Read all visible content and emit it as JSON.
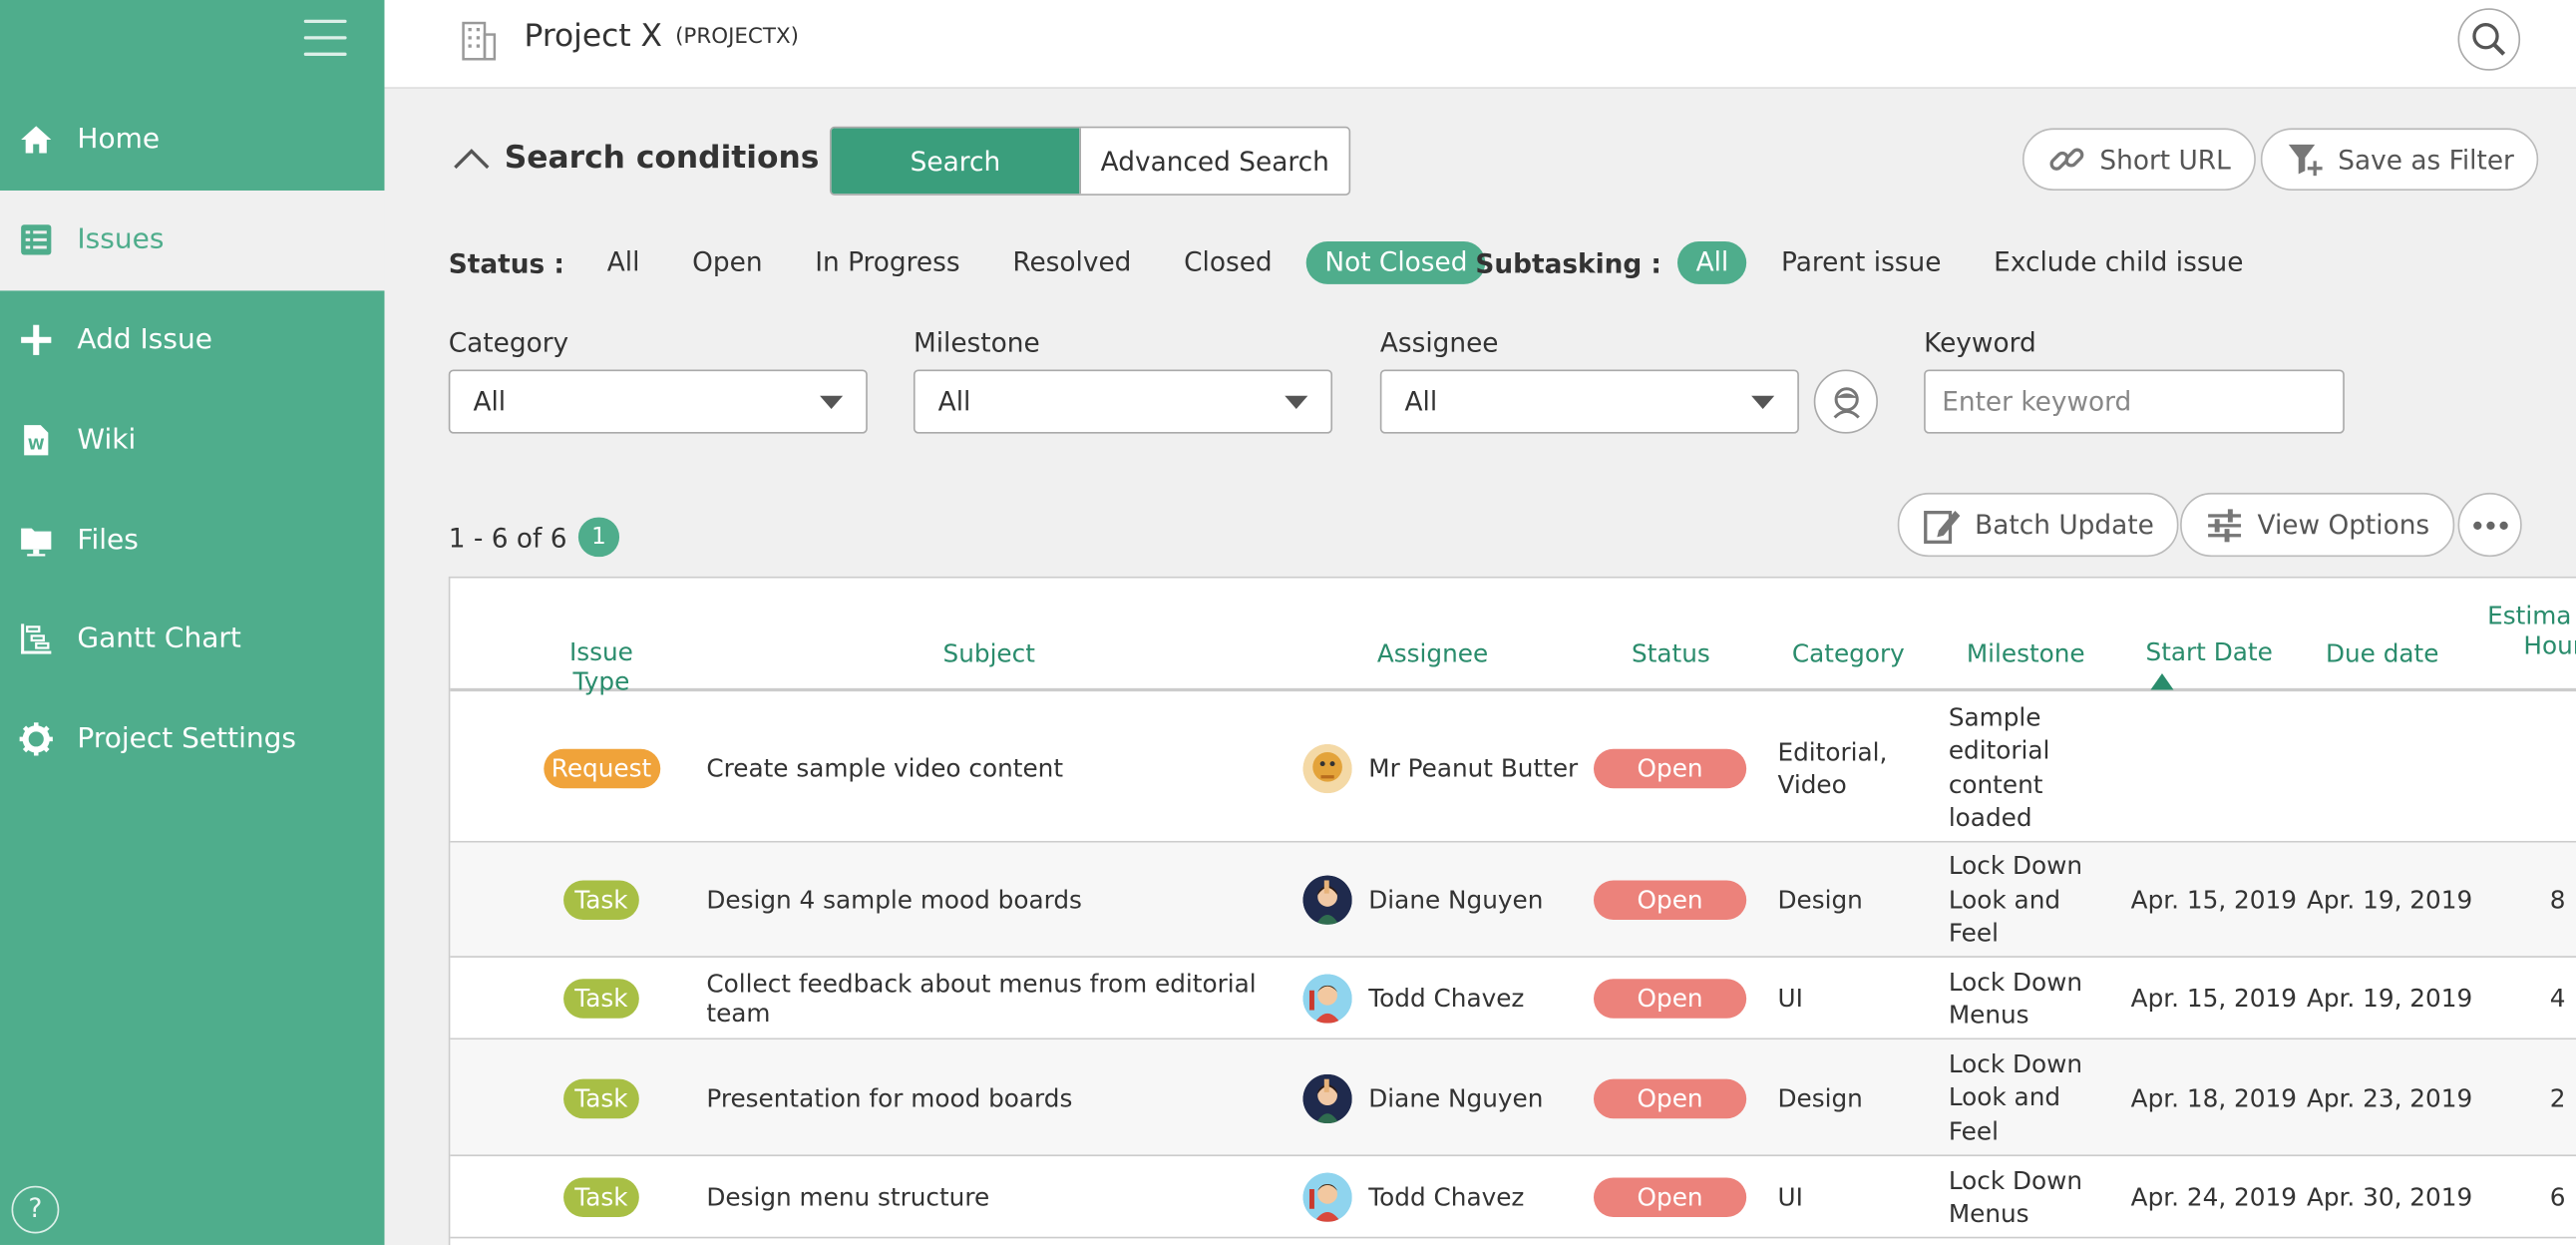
{
  "sidebar": {
    "items": [
      {
        "label": "Home",
        "icon": "home-icon",
        "active": false
      },
      {
        "label": "Issues",
        "icon": "list-icon",
        "active": true
      },
      {
        "label": "Add Issue",
        "icon": "plus-icon",
        "active": false
      },
      {
        "label": "Wiki",
        "icon": "wiki-icon",
        "active": false
      },
      {
        "label": "Files",
        "icon": "folder-icon",
        "active": false
      },
      {
        "label": "Gantt Chart",
        "icon": "gantt-icon",
        "active": false
      },
      {
        "label": "Project Settings",
        "icon": "gear-icon",
        "active": false
      }
    ],
    "help_label": "?"
  },
  "header": {
    "project_name": "Project X",
    "project_key": "(PROJECTX)"
  },
  "search": {
    "title": "Search conditions",
    "tab_search": "Search",
    "tab_advanced": "Advanced Search",
    "short_url": "Short URL",
    "save_filter": "Save as Filter",
    "status_label": "Status :",
    "status_options": [
      "All",
      "Open",
      "In Progress",
      "Resolved",
      "Closed",
      "Not Closed"
    ],
    "status_selected": "Not Closed",
    "subtasking_label": "Subtasking :",
    "subtasking_options": [
      "All",
      "Parent issue",
      "Exclude child issue"
    ],
    "subtasking_selected": "All",
    "category_label": "Category",
    "category_value": "All",
    "milestone_label": "Milestone",
    "milestone_value": "All",
    "assignee_label": "Assignee",
    "assignee_value": "All",
    "keyword_label": "Keyword",
    "keyword_placeholder": "Enter keyword"
  },
  "results": {
    "count": "1 - 6 of 6",
    "page": "1",
    "batch_update": "Batch Update",
    "view_options": "View Options"
  },
  "table": {
    "headers": {
      "issue_type": "Issue Type",
      "subject": "Subject",
      "assignee": "Assignee",
      "status": "Status",
      "category": "Category",
      "milestone": "Milestone",
      "start_date": "Start Date",
      "due_date": "Due date",
      "estimated_1": "Estima",
      "estimated_2": "Hour"
    },
    "rows": [
      {
        "type": "Request",
        "type_color": "#f0a33a",
        "subject": "Create sample video content",
        "assignee": "Mr Peanut Butter",
        "avatar": "peanut",
        "status": "Open",
        "category": "Editorial, Video",
        "milestone": "Sample editorial content loaded",
        "start": "",
        "due": "",
        "hours": ""
      },
      {
        "type": "Task",
        "type_color": "#a8bf45",
        "subject": "Design 4 sample mood boards",
        "assignee": "Diane Nguyen",
        "avatar": "diane",
        "status": "Open",
        "category": "Design",
        "milestone": "Lock Down Look and Feel",
        "start": "Apr. 15, 2019",
        "due": "Apr. 19, 2019",
        "hours": "8"
      },
      {
        "type": "Task",
        "type_color": "#a8bf45",
        "subject": "Collect feedback about menus from editorial team",
        "assignee": "Todd Chavez",
        "avatar": "todd",
        "status": "Open",
        "category": "UI",
        "milestone": "Lock Down Menus",
        "start": "Apr. 15, 2019",
        "due": "Apr. 19, 2019",
        "hours": "4"
      },
      {
        "type": "Task",
        "type_color": "#a8bf45",
        "subject": "Presentation for mood boards",
        "assignee": "Diane Nguyen",
        "avatar": "diane",
        "status": "Open",
        "category": "Design",
        "milestone": "Lock Down Look and Feel",
        "start": "Apr. 18, 2019",
        "due": "Apr. 23, 2019",
        "hours": "2"
      },
      {
        "type": "Task",
        "type_color": "#a8bf45",
        "subject": "Design menu structure",
        "assignee": "Todd Chavez",
        "avatar": "todd",
        "status": "Open",
        "category": "UI",
        "milestone": "Lock Down Menus",
        "start": "Apr. 24, 2019",
        "due": "Apr. 30, 2019",
        "hours": "6"
      }
    ]
  }
}
